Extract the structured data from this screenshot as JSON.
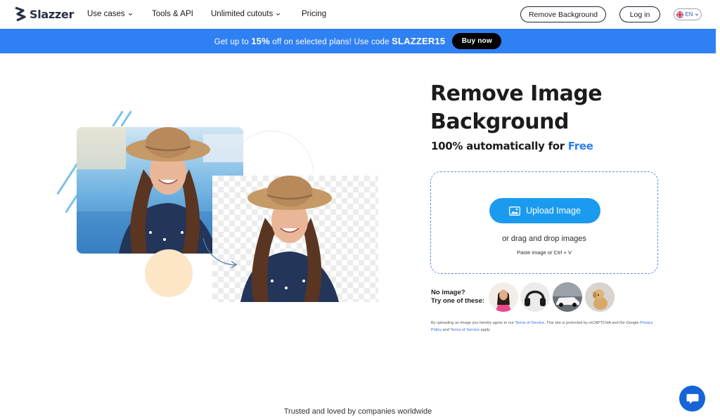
{
  "header": {
    "logo_text": "Slazzer",
    "nav": [
      {
        "label": "Use cases",
        "has_dropdown": true
      },
      {
        "label": "Tools & API",
        "has_dropdown": false
      },
      {
        "label": "Unlimited cutouts",
        "has_dropdown": true
      },
      {
        "label": "Pricing",
        "has_dropdown": false
      }
    ],
    "remove_bg_button": "Remove Background",
    "login_button": "Log in",
    "language": "EN"
  },
  "promo": {
    "text_before": "Get up to",
    "discount": "15%",
    "text_middle": "off on selected plans! Use code",
    "code": "SLAZZER15",
    "buy_button": "Buy now"
  },
  "hero": {
    "title_line1": "Remove Image",
    "title_line2": "Background",
    "subtitle_prefix": "100% automatically for",
    "subtitle_highlight": "Free",
    "upload_button": "Upload Image",
    "drag_text": "or drag and drop images",
    "paste_text": "Paste image or Ctrl + V",
    "no_image_line1": "No image?",
    "no_image_line2": "Try one of these:",
    "samples": [
      "woman-sample",
      "headphones-sample",
      "car-sample",
      "dog-sample"
    ],
    "legal": {
      "t1": "By uploading an image you hereby agree to our",
      "link1": "Terms of Service",
      "t2": ". This site is protected by reCAPTCHA and the Google",
      "link2": "Privacy Policy",
      "t3": "and",
      "link3": "Terms of Service",
      "t4": "apply"
    }
  },
  "footer": {
    "trusted": "Trusted and loved by companies worldwide"
  },
  "colors": {
    "promo_bg": "#2f80f2",
    "upload_bg": "#1a9bef",
    "free_accent": "#2f80f2",
    "chat_bg": "#1565d8"
  },
  "icons": [
    "slazzer-logo-icon",
    "chevron-down-icon",
    "uk-flag-icon",
    "image-icon",
    "chat-icon"
  ]
}
